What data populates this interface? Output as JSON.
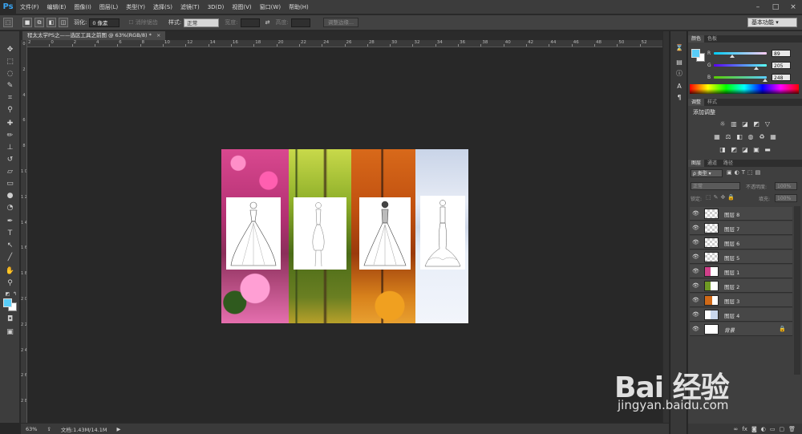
{
  "app": {
    "logo": "Ps"
  },
  "menu": {
    "items": [
      "文件(F)",
      "编辑(E)",
      "图像(I)",
      "图层(L)",
      "类型(Y)",
      "选择(S)",
      "滤镜(T)",
      "3D(D)",
      "视图(V)",
      "窗口(W)",
      "帮助(H)"
    ]
  },
  "window_controls": {
    "minimize": "–",
    "restore": "□",
    "close": "×"
  },
  "options_bar": {
    "feather_label": "羽化:",
    "feather_value": "0 像素",
    "antialias_label": "消除锯齿",
    "style_label": "样式:",
    "style_value": "正常",
    "width_label": "宽度:",
    "height_label": "高度:",
    "refine_edge": "调整边缘...",
    "workspace": "基本功能"
  },
  "document": {
    "tab_title": "程太太学PS之——选区工具之前图 @ 63%(RGB/8) *",
    "close": "×"
  },
  "ruler": {
    "h_ticks": [
      "2",
      "0",
      "2",
      "4",
      "6",
      "8",
      "10",
      "12",
      "14",
      "16",
      "18",
      "20",
      "22",
      "24",
      "26",
      "28",
      "30",
      "32",
      "34",
      "36",
      "38",
      "40",
      "42",
      "44",
      "46",
      "48",
      "50",
      "52"
    ],
    "v_ticks": [
      "0",
      "2",
      "4",
      "6",
      "8",
      "1 0",
      "1 2",
      "1 4",
      "1 6",
      "1 8",
      "2 0",
      "2 2",
      "2 4",
      "2 6",
      "2 8"
    ]
  },
  "status": {
    "zoom": "63%",
    "doc_info": "文档:1.43M/14.1M"
  },
  "color_panel": {
    "tabs": [
      "颜色",
      "色板"
    ],
    "r_label": "R",
    "g_label": "G",
    "b_label": "B",
    "r": "89",
    "g": "205",
    "b": "248",
    "r_value": 0.349,
    "g_value": 0.804,
    "b_value": 0.973,
    "foreground": "#59cdf8",
    "background": "#ffffff"
  },
  "adjustments_panel": {
    "tabs": [
      "调整",
      "样式"
    ],
    "title": "添加调整"
  },
  "layers_panel": {
    "tabs": [
      "图层",
      "通道",
      "路径"
    ],
    "filter_label": "ρ 类型",
    "blend_mode": "正常",
    "opacity_label": "不透明度:",
    "opacity_value": "100%",
    "lock_label": "锁定:",
    "fill_label": "填充:",
    "fill_value": "100%",
    "layers": [
      {
        "name": "图层 8",
        "thumb": "transparent"
      },
      {
        "name": "图层 7",
        "thumb": "transparent"
      },
      {
        "name": "图层 6",
        "thumb": "transparent"
      },
      {
        "name": "图层 5",
        "thumb": "transparent"
      },
      {
        "name": "图层 1",
        "thumb": "pink"
      },
      {
        "name": "图层 2",
        "thumb": "green"
      },
      {
        "name": "图层 3",
        "thumb": "orange"
      },
      {
        "name": "图层 4",
        "thumb": "snow"
      },
      {
        "name": "背景",
        "thumb": "white",
        "locked": true
      }
    ]
  },
  "watermark": {
    "logo": "Bai 经验",
    "url": "jingyan.baidu.com"
  },
  "colors": {
    "accent": "#39a3f0",
    "strip_pink": "#c9307a",
    "strip_green": "#6f8f23",
    "strip_orange": "#c45c12",
    "strip_snow": "#dfe6f2"
  }
}
